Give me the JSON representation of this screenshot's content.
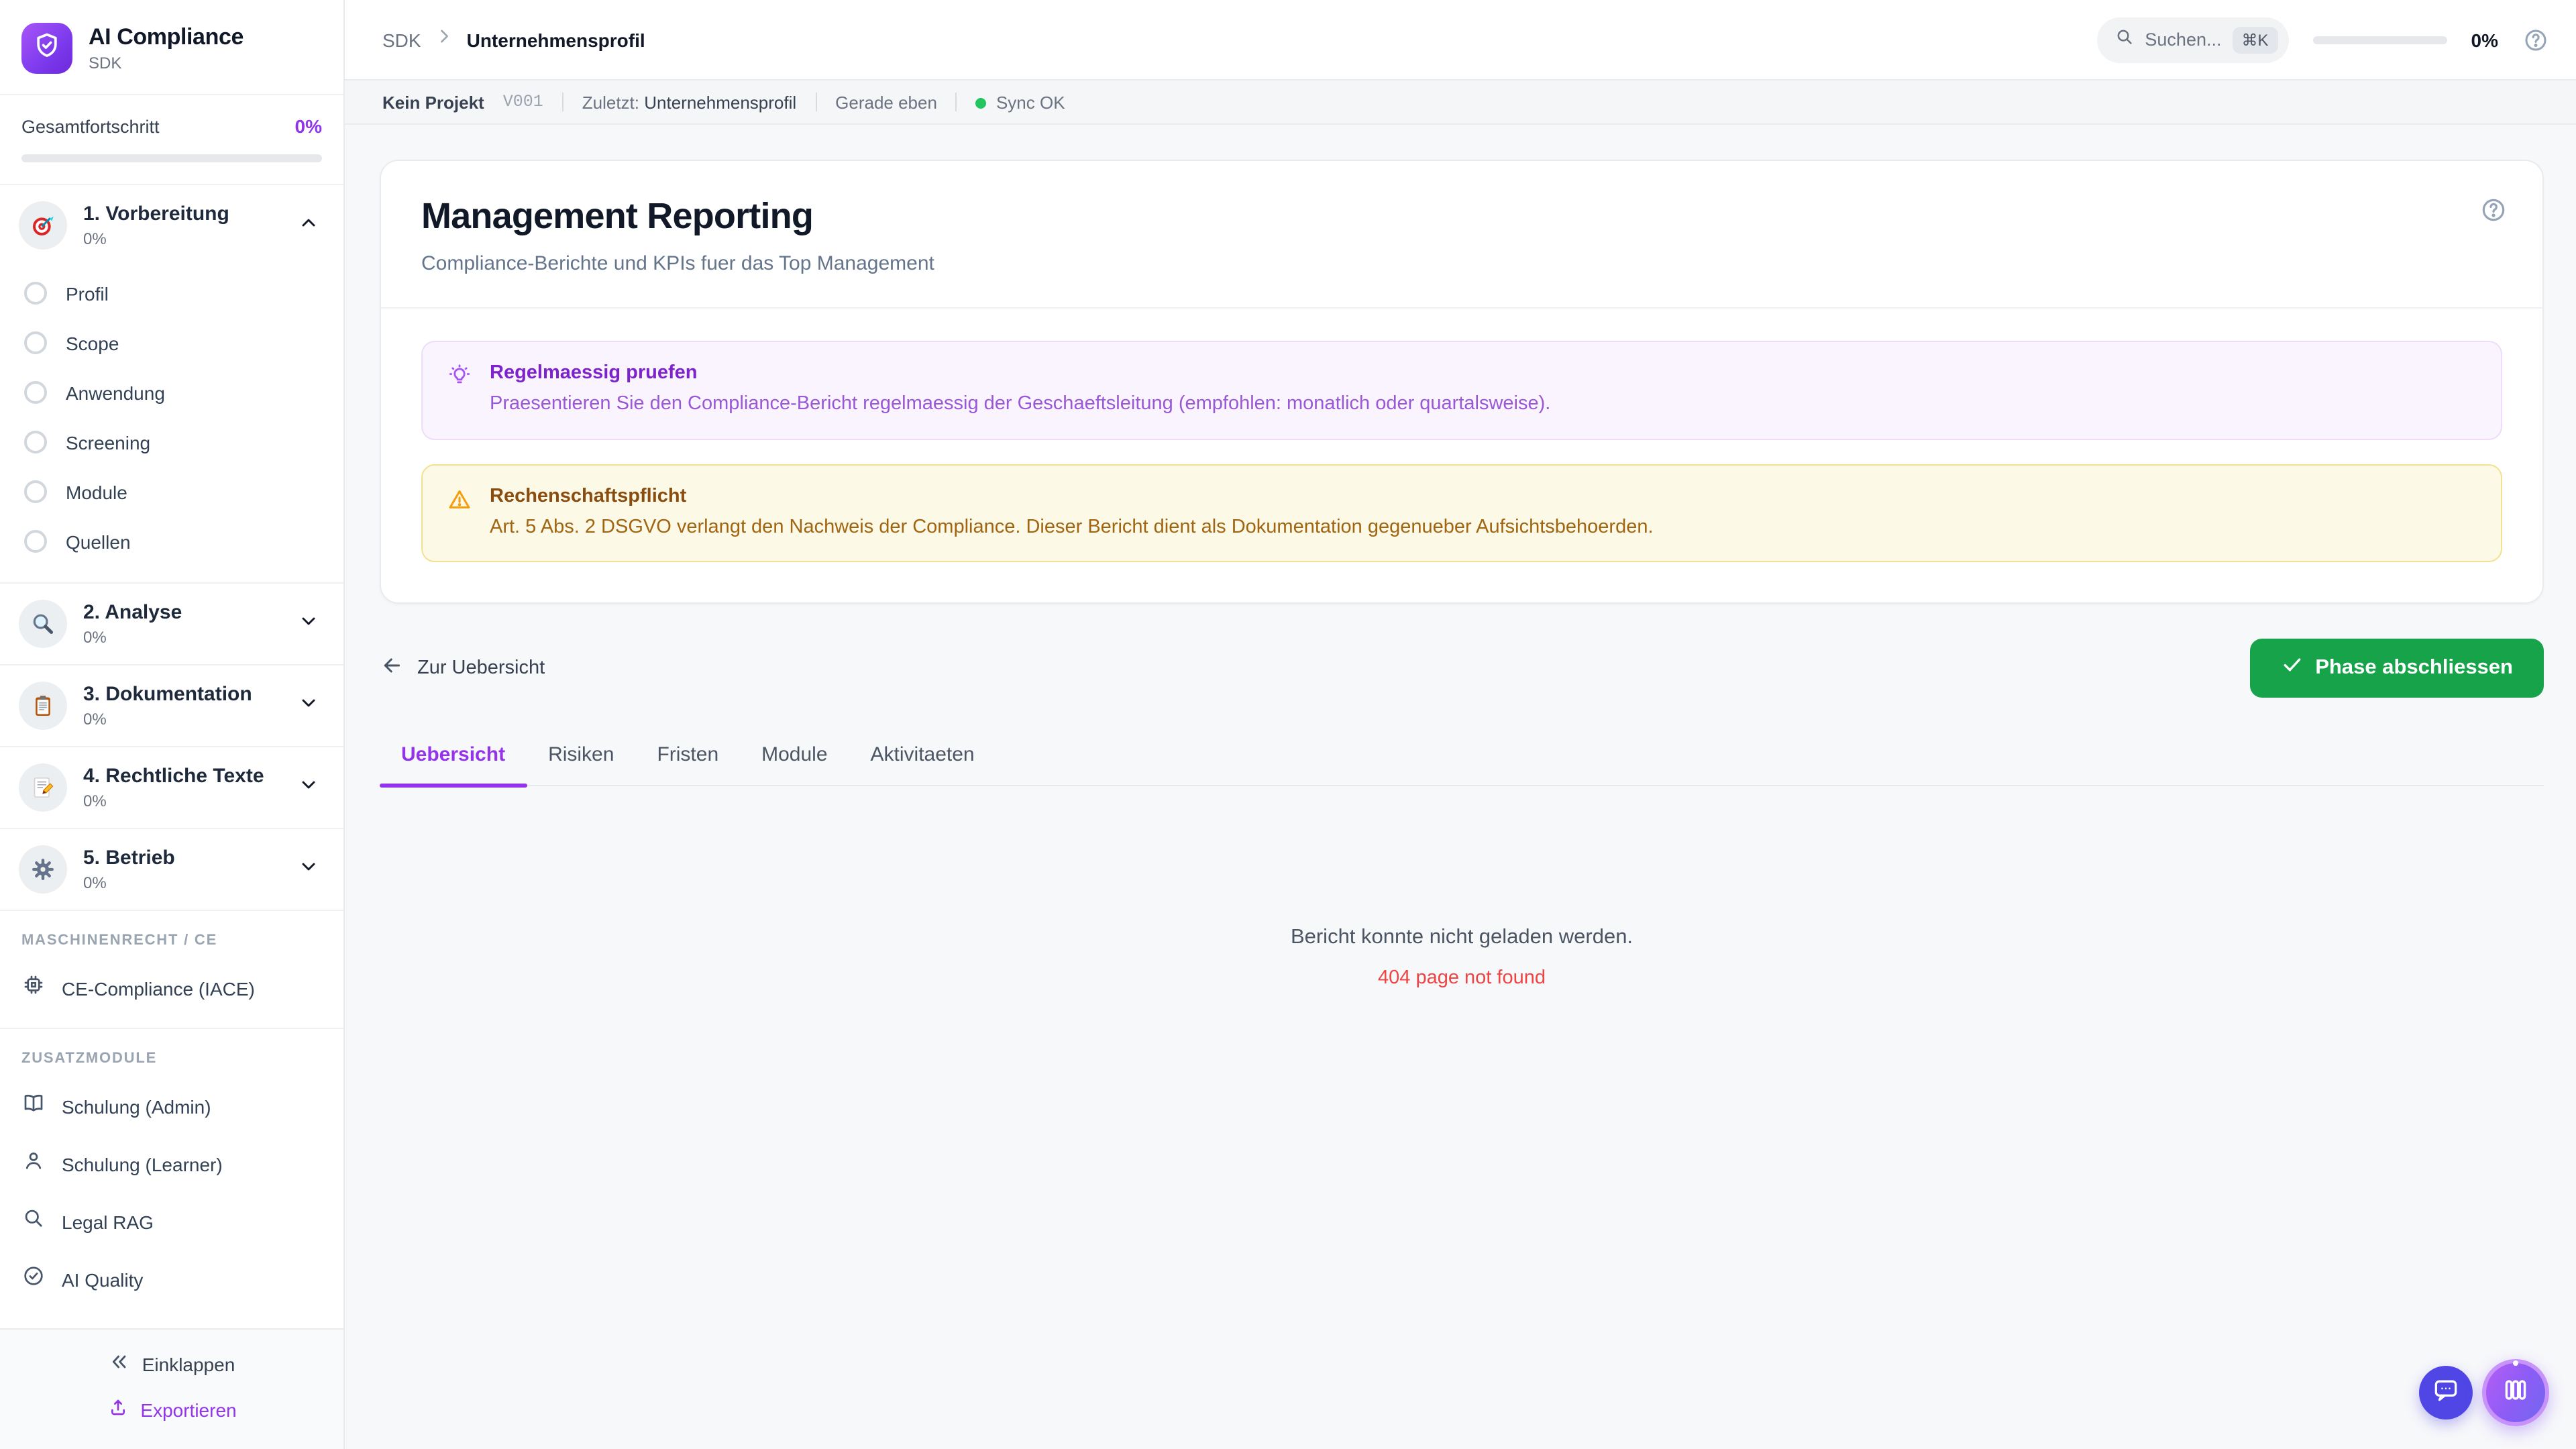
{
  "brand": {
    "title": "AI Compliance",
    "subtitle": "SDK",
    "logo_icon": "shield-check-icon"
  },
  "overall": {
    "label": "Gesamtfortschritt",
    "value": "0%",
    "percent": 0
  },
  "sidebar": {
    "phases": [
      {
        "icon": "target-icon",
        "label": "1. Vorbereitung",
        "percent": "0%",
        "expanded": true,
        "items": [
          "Profil",
          "Scope",
          "Anwendung",
          "Screening",
          "Module",
          "Quellen"
        ]
      },
      {
        "icon": "magnifier-icon",
        "label": "2. Analyse",
        "percent": "0%",
        "expanded": false
      },
      {
        "icon": "clipboard-icon",
        "label": "3. Dokumentation",
        "percent": "0%",
        "expanded": false
      },
      {
        "icon": "memo-icon",
        "label": "4. Rechtliche Texte",
        "percent": "0%",
        "expanded": false
      },
      {
        "icon": "gear-icon",
        "label": "5. Betrieb",
        "percent": "0%",
        "expanded": false
      }
    ],
    "sections": [
      {
        "header": "MASCHINENRECHT / CE",
        "items": [
          {
            "icon": "cpu-icon",
            "label": "CE-Compliance (IACE)"
          }
        ]
      },
      {
        "header": "ZUSATZMODULE",
        "items": [
          {
            "icon": "book-icon",
            "label": "Schulung (Admin)"
          },
          {
            "icon": "user-icon",
            "label": "Schulung (Learner)"
          },
          {
            "icon": "search-icon",
            "label": "Legal RAG"
          },
          {
            "icon": "check-circle-icon",
            "label": "AI Quality"
          }
        ]
      }
    ],
    "footer": {
      "collapse": "Einklappen",
      "export": "Exportieren"
    }
  },
  "topbar": {
    "breadcrumb": {
      "root": "SDK",
      "current": "Unternehmensprofil"
    },
    "search": {
      "placeholder": "Suchen...",
      "shortcut": "⌘K"
    },
    "progress": {
      "value": "0%",
      "percent": 0
    }
  },
  "statusbar": {
    "project": "Kein Projekt",
    "version": "V001",
    "last_label": "Zuletzt:",
    "last_value": "Unternehmensprofil",
    "time": "Gerade eben",
    "sync": "Sync OK"
  },
  "page": {
    "title": "Management Reporting",
    "subtitle": "Compliance-Berichte und KPIs fuer das Top Management"
  },
  "alerts": [
    {
      "type": "tip",
      "icon": "lightbulb-icon",
      "title": "Regelmaessig pruefen",
      "body": "Praesentieren Sie den Compliance-Bericht regelmaessig der Geschaeftsleitung (empfohlen: monatlich oder quartalsweise)."
    },
    {
      "type": "warning",
      "icon": "warning-triangle-icon",
      "title": "Rechenschaftspflicht",
      "body": "Art. 5 Abs. 2 DSGVO verlangt den Nachweis der Compliance. Dieser Bericht dient als Dokumentation gegenueber Aufsichtsbehoerden."
    }
  ],
  "actions": {
    "back": "Zur Uebersicht",
    "complete": "Phase abschliessen"
  },
  "tabs": [
    {
      "label": "Uebersicht",
      "active": true
    },
    {
      "label": "Risiken",
      "active": false
    },
    {
      "label": "Fristen",
      "active": false
    },
    {
      "label": "Module",
      "active": false
    },
    {
      "label": "Aktivitaeten",
      "active": false
    }
  ],
  "empty_state": {
    "message": "Bericht konnte nicht geladen werden.",
    "error": "404 page not found"
  },
  "colors": {
    "accent_purple": "#9333ea",
    "success_green": "#16a34a",
    "sync_green": "#22c55e",
    "error_red": "#ef4444",
    "fab_indigo": "#4f46e5",
    "warning_amber": "#f59e0b"
  }
}
